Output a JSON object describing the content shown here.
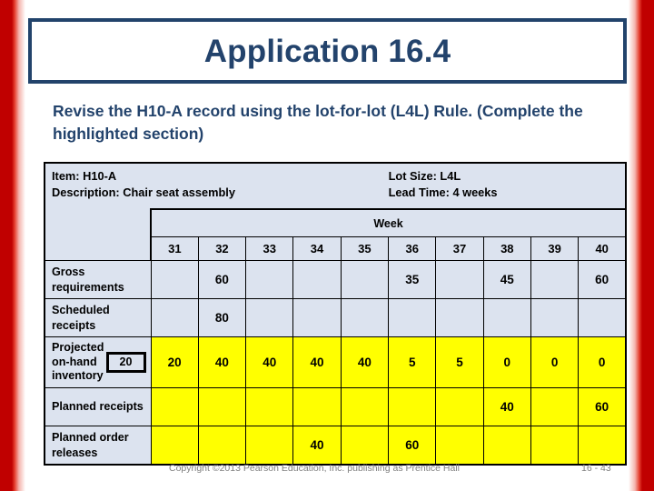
{
  "slide": {
    "title": "Application 16.4",
    "subtitle": "Revise the H10-A record using the lot-for-lot (L4L) Rule.  (Complete the highlighted section)",
    "accent_color": "#23436C",
    "edge_color": "#C00000",
    "highlight_color": "#FFFF00",
    "cell_fill_color": "#DCE3EF"
  },
  "record": {
    "item_label": "Item: H10-A",
    "description_label": "Description: Chair seat assembly",
    "lot_size_label": "Lot Size: L4L",
    "lead_time_label": "Lead Time: 4 weeks",
    "week_banner": "Week"
  },
  "table": {
    "weeks": [
      "31",
      "32",
      "33",
      "34",
      "35",
      "36",
      "37",
      "38",
      "39",
      "40"
    ],
    "rows": [
      {
        "label": "Gross requirements",
        "highlighted": false,
        "values": [
          "",
          "60",
          "",
          "",
          "",
          "35",
          "",
          "45",
          "",
          "60"
        ]
      },
      {
        "label": "Scheduled receipts",
        "highlighted": false,
        "values": [
          "",
          "80",
          "",
          "",
          "",
          "",
          "",
          "",
          "",
          ""
        ]
      },
      {
        "label": "Projected on-hand inventory",
        "highlighted": true,
        "starting_inventory": "20",
        "values": [
          "20",
          "40",
          "40",
          "40",
          "40",
          "5",
          "5",
          "0",
          "0",
          "0"
        ]
      },
      {
        "label": "Planned receipts",
        "highlighted": true,
        "values": [
          "",
          "",
          "",
          "",
          "",
          "",
          "",
          "40",
          "",
          "60"
        ]
      },
      {
        "label": "Planned order releases",
        "highlighted": true,
        "values": [
          "",
          "",
          "",
          "40",
          "",
          "60",
          "",
          "",
          "",
          ""
        ]
      }
    ]
  },
  "footer": {
    "copyright": "Copyright ©2013 Pearson Education, Inc. publishing as Prentice Hall",
    "page_number": "16 - 43"
  }
}
